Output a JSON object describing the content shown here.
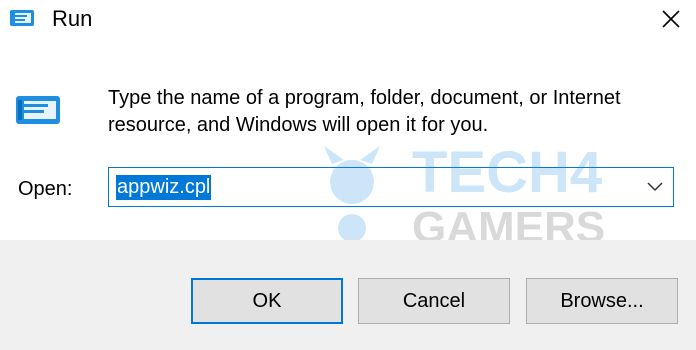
{
  "window": {
    "title": "Run",
    "close_glyph": "✕"
  },
  "icons": {
    "title": "run-icon",
    "main": "run-icon",
    "close": "close-icon",
    "dropdown": "chevron-down-icon"
  },
  "dialog": {
    "description": "Type the name of a program, folder, document, or Internet resource, and Windows will open it for you.",
    "open_label": "Open:",
    "input_value": "appwiz.cpl"
  },
  "watermark": {
    "line1": "TECH4",
    "line2": "GAMERS"
  },
  "buttons": {
    "ok": "OK",
    "cancel": "Cancel",
    "browse": "Browse..."
  },
  "colors": {
    "accent": "#0078d7",
    "footer_bg": "#f0f0f0",
    "button_bg": "#e1e1e1",
    "icon_blue": "#1e8ee0"
  }
}
